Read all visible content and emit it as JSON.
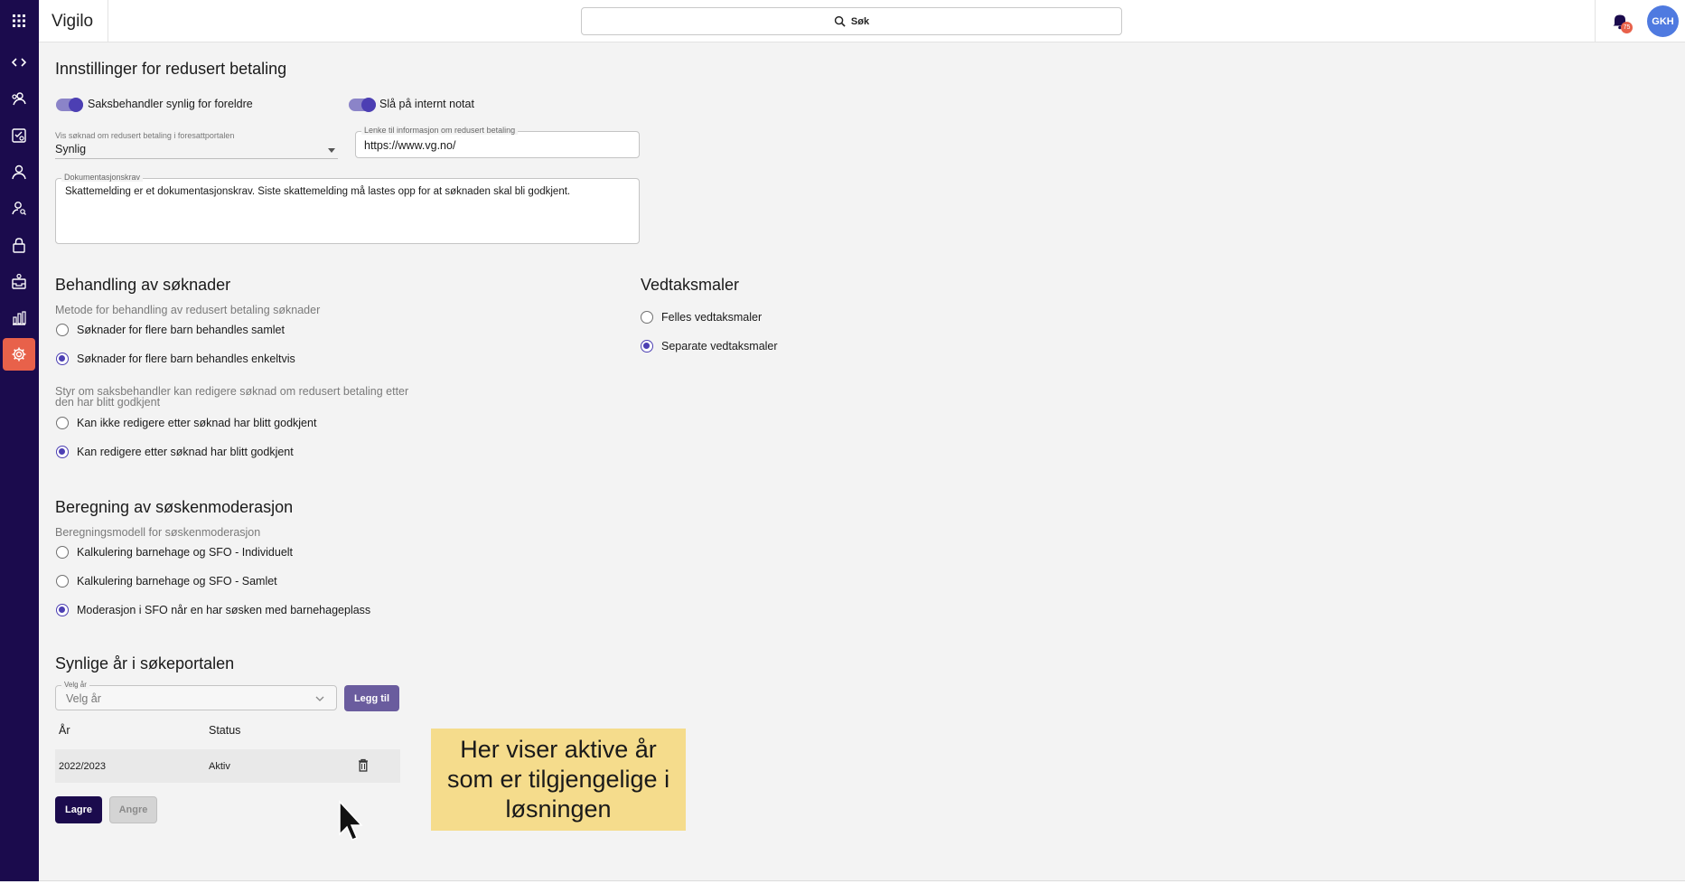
{
  "app": {
    "brand": "Vigilo"
  },
  "search": {
    "label": "Søk"
  },
  "notifications": {
    "count": "75"
  },
  "user": {
    "initials": "GKH"
  },
  "sidebar": {
    "items": [
      {
        "icon": "apps-grid-icon"
      },
      {
        "icon": "code-arrows-icon"
      },
      {
        "icon": "people-icon"
      },
      {
        "icon": "checklist-icon"
      },
      {
        "icon": "person-icon"
      },
      {
        "icon": "user-search-icon"
      },
      {
        "icon": "lock-icon"
      },
      {
        "icon": "inbox-icon"
      },
      {
        "icon": "bar-chart-icon"
      },
      {
        "icon": "gear-icon",
        "active": true
      }
    ]
  },
  "reduced_payment": {
    "title": "Innstillinger for redusert betaling",
    "toggle_visible_label": "Saksbehandler synlig for foreldre",
    "toggle_internal_note_label": "Slå på internt notat",
    "show_application_label": "Vis søknad om redusert betaling i foresattportalen",
    "show_application_value": "Synlig",
    "link_label": "Lenke til informasjon om redusert betaling",
    "link_value": "https://www.vg.no/",
    "documentation_label": "Dokumentasjonskrav",
    "documentation_value": "Skattemelding er et dokumentasjonskrav. Siste skattemelding må lastes opp for at søknaden skal bli godkjent."
  },
  "processing": {
    "title": "Behandling av søknader",
    "method_hint": "Metode for behandling av redusert betaling søknader",
    "method_options": [
      {
        "label": "Søknader for flere barn behandles samlet",
        "selected": false
      },
      {
        "label": "Søknader for flere barn behandles enkeltvis",
        "selected": true
      }
    ],
    "edit_hint": "Styr om saksbehandler kan redigere søknad om redusert betaling etter den har blitt godkjent",
    "edit_options": [
      {
        "label": "Kan ikke redigere etter søknad har blitt godkjent",
        "selected": false
      },
      {
        "label": "Kan redigere etter søknad har blitt godkjent",
        "selected": true
      }
    ]
  },
  "templates": {
    "title": "Vedtaksmaler",
    "options": [
      {
        "label": "Felles vedtaksmaler",
        "selected": false
      },
      {
        "label": "Separate vedtaksmaler",
        "selected": true
      }
    ]
  },
  "sibling": {
    "title": "Beregning av søskenmoderasjon",
    "hint": "Beregningsmodell for søskenmoderasjon",
    "options": [
      {
        "label": "Kalkulering barnehage og SFO - Individuelt",
        "selected": false
      },
      {
        "label": "Kalkulering barnehage og SFO - Samlet",
        "selected": false
      },
      {
        "label": "Moderasjon i SFO når en har søsken med barnehageplass",
        "selected": true
      }
    ]
  },
  "years": {
    "title": "Synlige år i søkeportalen",
    "select_label": "Velg år",
    "select_placeholder": "Velg år",
    "add_button": "Legg til",
    "col_year": "År",
    "col_status": "Status",
    "rows": [
      {
        "year": "2022/2023",
        "status": "Aktiv"
      }
    ]
  },
  "actions": {
    "save": "Lagre",
    "cancel": "Angre"
  },
  "tooltip": {
    "text": "Her viser aktive år som er tilgjengelige i løsningen"
  }
}
